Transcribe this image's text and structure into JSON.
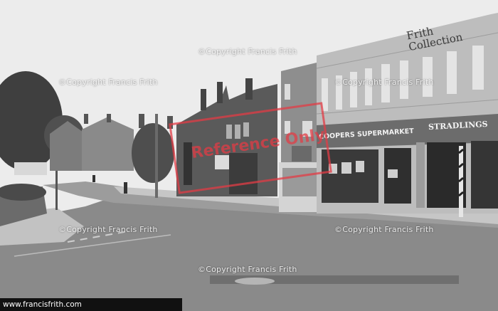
{
  "watermarks": [
    "©Copyright Francis Frith",
    "©Copyright Francis Frith",
    "©Copyright Francis Frith",
    "©Copyright Francis Frith",
    "©Copyright Francis Frith",
    "©Copyright Francis Frith"
  ],
  "stamp": {
    "text": "Reference Only"
  },
  "signs": {
    "frith_logo": "Frith Collection",
    "coopers": "COOPERS SUPERMARKET",
    "shop_right": "STRADLINGS"
  },
  "caption": {
    "text": "www.francisfrith.com"
  },
  "colors": {
    "stamp_red": "#e23c46",
    "caption_bg": "#111111"
  }
}
